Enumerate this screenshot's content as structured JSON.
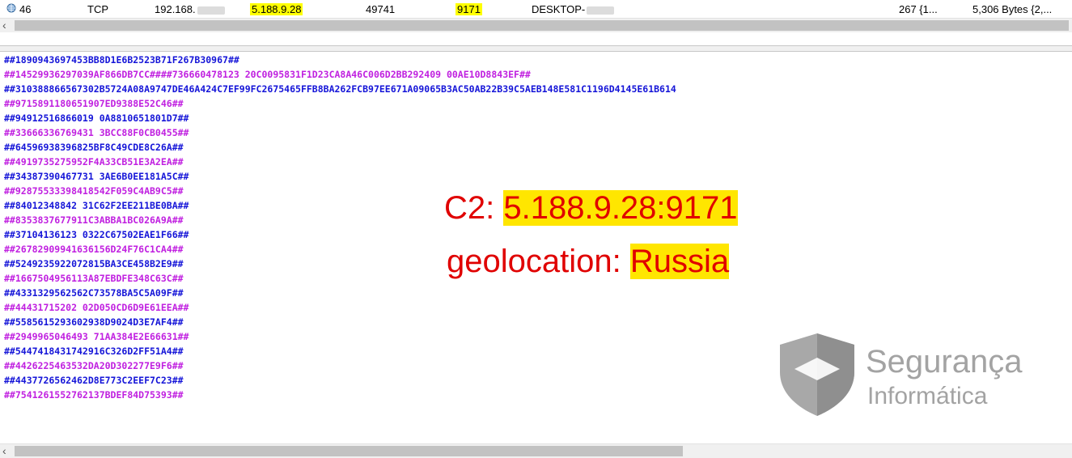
{
  "packet_row": {
    "no": "46",
    "protocol": "TCP",
    "src_ip": "192.168.",
    "dst_ip": "5.188.9.28",
    "src_port": "49741",
    "dst_port": "9171",
    "host": "DESKTOP-",
    "col_a": "267 {1...",
    "col_b": "5,306 Bytes {2,..."
  },
  "highlight_color": "#ffff00",
  "stream_colors": {
    "client": "#1515d8",
    "server": "#c020e0"
  },
  "stream_lines": [
    {
      "text": "##1890943697453BB8D1E6B2523B71F267B30967##",
      "side": "client"
    },
    {
      "text": "##14529936297039AF866DB7CC####736660478123 20C0095831F1D23CA8A46C006D2BB292409 00AE10D8843EF##",
      "side": "server"
    },
    {
      "text": "##310388866567302B5724A08A9747DE46A424C7EF99FC2675465FFB8BA262FCB97EE671A09065B3AC50AB22B39C5AEB148E581C1196D4145E61B614",
      "side": "client"
    },
    {
      "text": "##9715891180651907ED9388E52C46##",
      "side": "server"
    },
    {
      "text": "##94912516866019 0A8810651801D7##",
      "side": "client"
    },
    {
      "text": "##33666336769431 3BCC88F0CB0455##",
      "side": "server"
    },
    {
      "text": "##64596938396825BF8C49CDE8C26A##",
      "side": "client"
    },
    {
      "text": "##4919735275952F4A33CB51E3A2EA##",
      "side": "server"
    },
    {
      "text": "##34387390467731 3AE6B0EE181A5C##",
      "side": "client"
    },
    {
      "text": "##92875533398418542F059C4AB9C5##",
      "side": "server"
    },
    {
      "text": "##84012348842 31C62F2EE211BE0BA##",
      "side": "client"
    },
    {
      "text": "##8353837677911C3ABBA1BC026A9A##",
      "side": "server"
    },
    {
      "text": "##37104136123 0322C67502EAE1F66##",
      "side": "client"
    },
    {
      "text": "##26782909941636156D24F76C1CA4##",
      "side": "server"
    },
    {
      "text": "##5249235922072815BA3CE458B2E9##",
      "side": "client"
    },
    {
      "text": "##1667504956113A87EBDFE348C63C##",
      "side": "server"
    },
    {
      "text": "##4331329562562C73578BA5C5A09F##",
      "side": "client"
    },
    {
      "text": "##44431715202 02D050CD6D9E61EEA##",
      "side": "server"
    },
    {
      "text": "##5585615293602938D9024D3E7AF4##",
      "side": "client"
    },
    {
      "text": "##2949965046493 71AA384E2E66631##",
      "side": "server"
    },
    {
      "text": "##5447418431742916C326D2FF51A4##",
      "side": "client"
    },
    {
      "text": "##4426225463532DA20D302277E9F6##",
      "side": "server"
    },
    {
      "text": "##4437726562462D8E773C2EEF7C23##",
      "side": "client"
    },
    {
      "text": "##7541261552762137BDEF84D75393##",
      "side": "server"
    }
  ],
  "annotation": {
    "c2_label": "C2: ",
    "c2_value": "5.188.9.28:9171",
    "geo_label": "geolocation: ",
    "geo_value": "Russia",
    "text_color": "#e00000",
    "highlight_color": "#ffe600"
  },
  "watermark": {
    "line1": "Segurança",
    "line2": "Informática",
    "color": "#a3a3a3",
    "icon": "shield-icon"
  }
}
